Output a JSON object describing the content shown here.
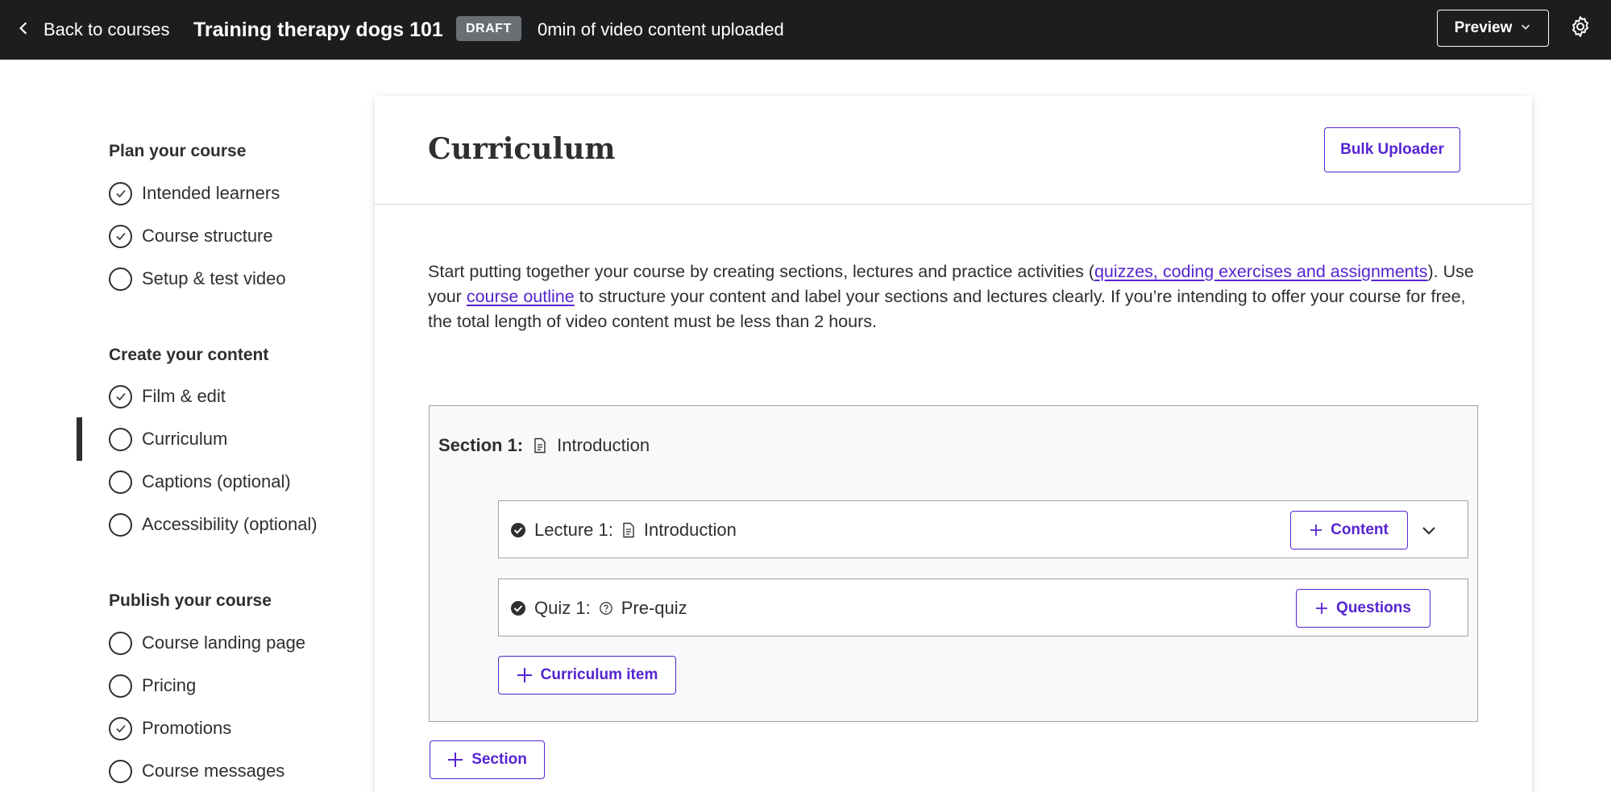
{
  "header": {
    "back_label": "Back to courses",
    "course_title": "Training therapy dogs 101",
    "status_badge": "DRAFT",
    "upload_status": "0min of video content uploaded",
    "preview_label": "Preview"
  },
  "sidebar": {
    "groups": [
      {
        "heading": "Plan your course",
        "items": [
          {
            "label": "Intended learners",
            "completed": true
          },
          {
            "label": "Course structure",
            "completed": true
          },
          {
            "label": "Setup & test video",
            "completed": false
          }
        ]
      },
      {
        "heading": "Create your content",
        "items": [
          {
            "label": "Film & edit",
            "completed": true
          },
          {
            "label": "Curriculum",
            "completed": false,
            "active": true
          },
          {
            "label": "Captions (optional)",
            "completed": false
          },
          {
            "label": "Accessibility (optional)",
            "completed": false
          }
        ]
      },
      {
        "heading": "Publish your course",
        "items": [
          {
            "label": "Course landing page",
            "completed": false
          },
          {
            "label": "Pricing",
            "completed": false
          },
          {
            "label": "Promotions",
            "completed": true
          },
          {
            "label": "Course messages",
            "completed": false
          }
        ]
      }
    ]
  },
  "main": {
    "title": "Curriculum",
    "bulk_uploader_label": "Bulk Uploader",
    "intro": {
      "part1": "Start putting together your course by creating sections, lectures and practice activities (",
      "link1": "quizzes, coding exercises and assignments",
      "part2": "). Use your ",
      "link2": "course outline",
      "part3": " to structure your content and label your sections and lectures clearly. If you’re intending to offer your course for free, the total length of video content must be less than 2 hours."
    },
    "section": {
      "prefix": "Section 1:",
      "title": "Introduction",
      "items": [
        {
          "prefix": "Lecture 1:",
          "title": "Introduction",
          "button_label": "Content"
        },
        {
          "prefix": "Quiz 1:",
          "title": "Pre-quiz",
          "button_label": "Questions"
        }
      ],
      "add_item_label": "Curriculum item"
    },
    "add_section_label": "Section"
  },
  "colors": {
    "header_bg": "#1c1d1f",
    "accent": "#5624d0",
    "text": "#2d2f31",
    "badge_bg": "#6a6f73",
    "section_bg": "#f7f9fa"
  }
}
